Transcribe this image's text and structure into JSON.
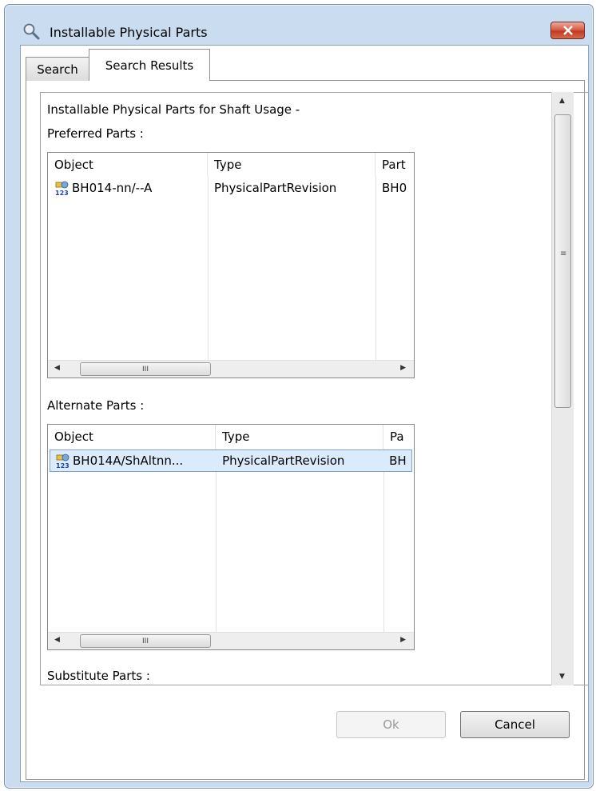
{
  "window": {
    "title": "Installable Physical Parts",
    "close_glyph": "✕"
  },
  "tabs": [
    {
      "label": "Search",
      "active": false
    },
    {
      "label": "Search Results",
      "active": true
    }
  ],
  "content": {
    "heading": "Installable Physical Parts for Shaft Usage -",
    "preferred": {
      "label": "Preferred Parts :",
      "columns": [
        "Object",
        "Type",
        "Part"
      ],
      "rows": [
        {
          "object": "BH014-nn/--A",
          "type": "PhysicalPartRevision",
          "part": "BH0"
        }
      ]
    },
    "alternate": {
      "label": "Alternate Parts :",
      "columns": [
        "Object",
        "Type",
        "Pa"
      ],
      "rows": [
        {
          "object": "BH014A/ShAltnn...",
          "type": "PhysicalPartRevision",
          "part": "BH"
        }
      ]
    },
    "substitute": {
      "label": "Substitute Parts :"
    },
    "scroll_left_glyph": "◀",
    "scroll_right_glyph": "▶",
    "scroll_grip": "III",
    "vscroll_up": "▲",
    "vscroll_down": "▼"
  },
  "buttons": {
    "ok": "Ok",
    "cancel": "Cancel"
  },
  "icons": {
    "title": "magnifier-icon",
    "row": "physical-part-revision-icon",
    "close": "close-icon"
  },
  "colors": {
    "window_frame": "#c9dcf0",
    "close_button": "#c23a22",
    "selection": "#dcebfc"
  }
}
